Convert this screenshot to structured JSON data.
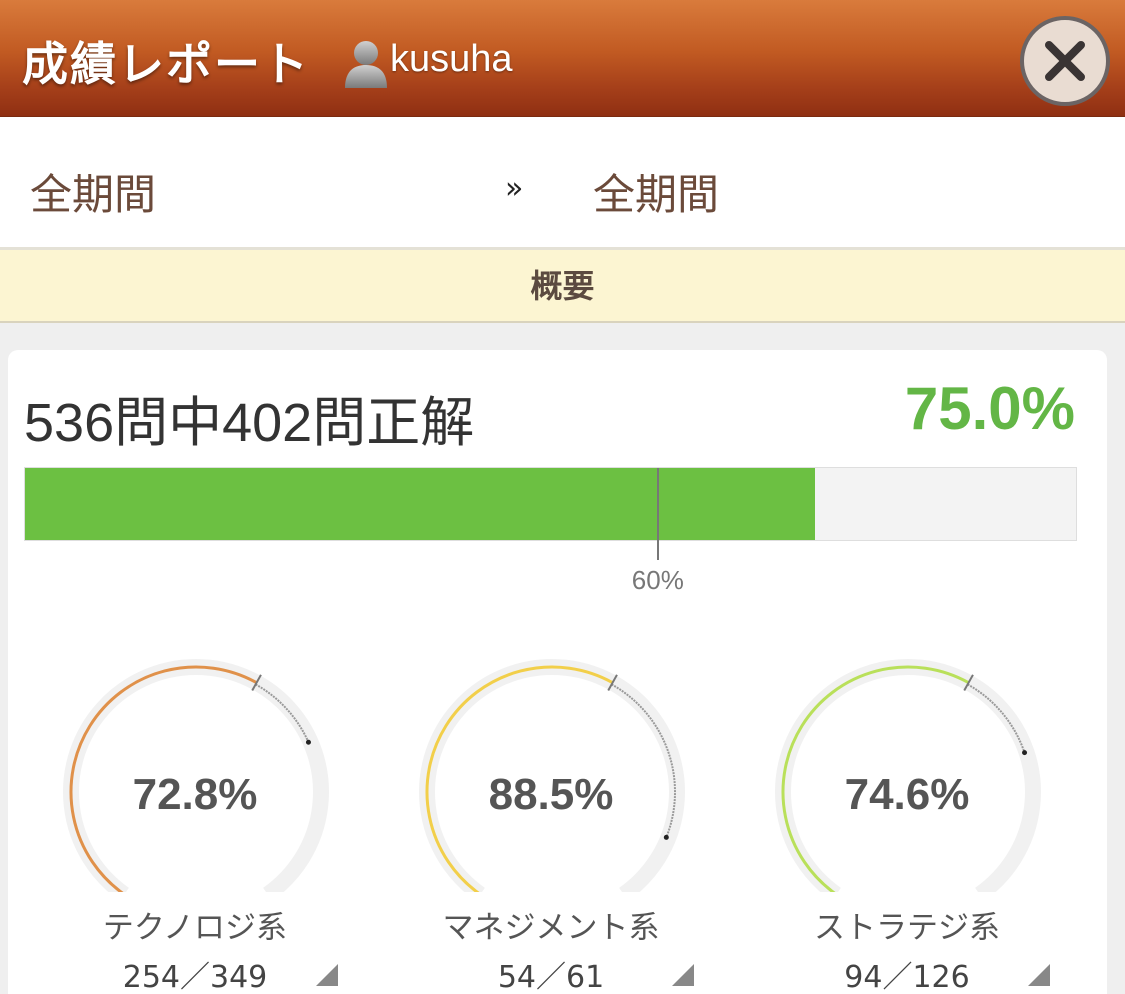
{
  "header": {
    "title": "成績レポート",
    "username": "kusuha"
  },
  "period": {
    "from": "全期間",
    "arrow": "»",
    "to": "全期間"
  },
  "section": {
    "title": "概要"
  },
  "summary": {
    "text": "536問中402問正解",
    "rate_label": "75.0%",
    "correct": 402,
    "total": 536,
    "rate": 0.75,
    "pass_line": 0.6,
    "pass_line_label": "60%"
  },
  "categories": [
    {
      "name": "テクノロジ系",
      "rate_label": "72.8%",
      "rate": 0.728,
      "count_label": "254／349",
      "color": "#e0914a"
    },
    {
      "name": "マネジメント系",
      "rate_label": "88.5%",
      "rate": 0.885,
      "count_label": "54／61",
      "color": "#f2cf4a"
    },
    {
      "name": "ストラテジ系",
      "rate_label": "74.6%",
      "rate": 0.746,
      "count_label": "94／126",
      "color": "#b9e05a"
    }
  ],
  "colors": {
    "header_top": "#d97b3c",
    "header_bottom": "#8f2f12",
    "accent_green": "#6cc042",
    "rate_text": "#63b646",
    "section_bg": "#fcf5d2"
  },
  "icons": {
    "user": "user-silhouette-icon",
    "close": "close-x-icon"
  }
}
